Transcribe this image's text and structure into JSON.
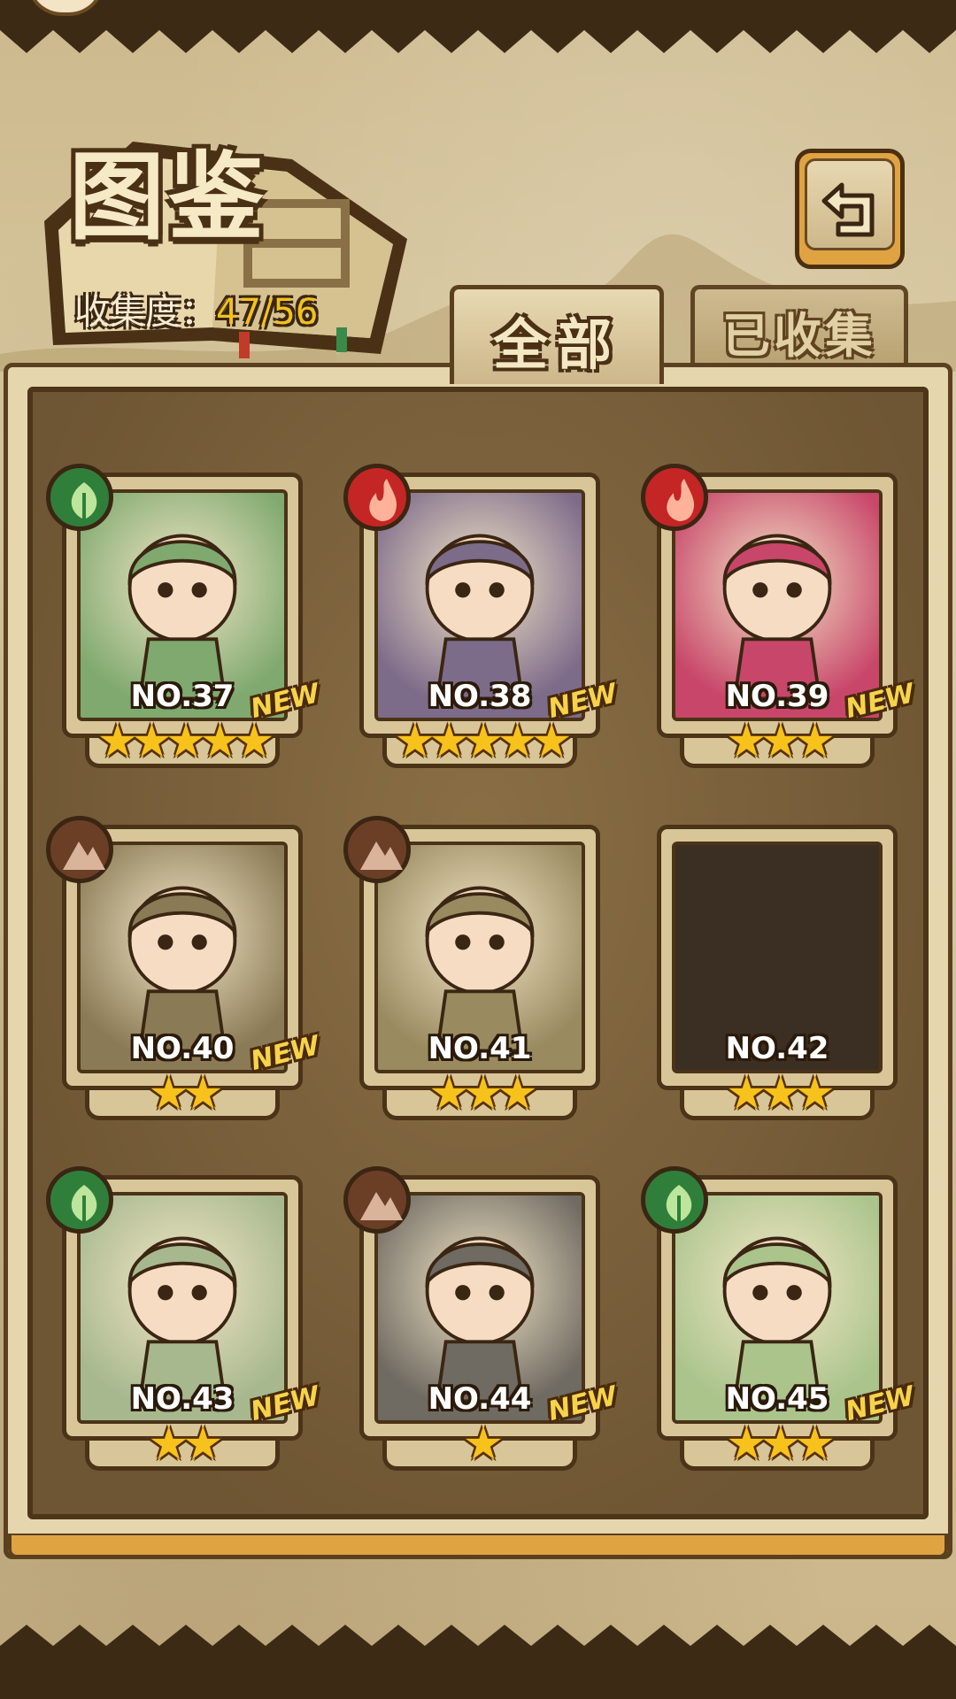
{
  "header": {
    "title": "图鉴",
    "collection_label": "收集度：",
    "collection_value": "47/56"
  },
  "tabs": [
    {
      "label": "全部",
      "active": true
    },
    {
      "label": "已收集",
      "active": false
    }
  ],
  "colors": {
    "leaf": "#2f7f3a",
    "fire": "#c42525",
    "earth": "#6b3f26",
    "star": "#f7c21c",
    "new_tag": "#f7d34a"
  },
  "cards": [
    {
      "number": "NO.37",
      "stars": "★★★★★",
      "star_count": 5,
      "element": "leaf-icon",
      "new": "NEW",
      "silhouette": false
    },
    {
      "number": "NO.38",
      "stars": "★★★★★",
      "star_count": 5,
      "element": "fire-icon",
      "new": "NEW",
      "silhouette": false
    },
    {
      "number": "NO.39",
      "stars": "★★★",
      "star_count": 3,
      "element": "fire-icon",
      "new": "NEW",
      "silhouette": false
    },
    {
      "number": "NO.40",
      "stars": "★★",
      "star_count": 2,
      "element": "earth-icon",
      "new": "NEW",
      "silhouette": false
    },
    {
      "number": "NO.41",
      "stars": "★★★",
      "star_count": 3,
      "element": "earth-icon",
      "new": "",
      "silhouette": false
    },
    {
      "number": "NO.42",
      "stars": "★★★",
      "star_count": 3,
      "element": "",
      "new": "",
      "silhouette": true
    },
    {
      "number": "NO.43",
      "stars": "★★",
      "star_count": 2,
      "element": "leaf-icon",
      "new": "NEW",
      "silhouette": false
    },
    {
      "number": "NO.44",
      "stars": "★",
      "star_count": 1,
      "element": "earth-icon",
      "new": "NEW",
      "silhouette": false
    },
    {
      "number": "NO.45",
      "stars": "★★★",
      "star_count": 3,
      "element": "leaf-icon",
      "new": "NEW",
      "silhouette": false
    }
  ]
}
